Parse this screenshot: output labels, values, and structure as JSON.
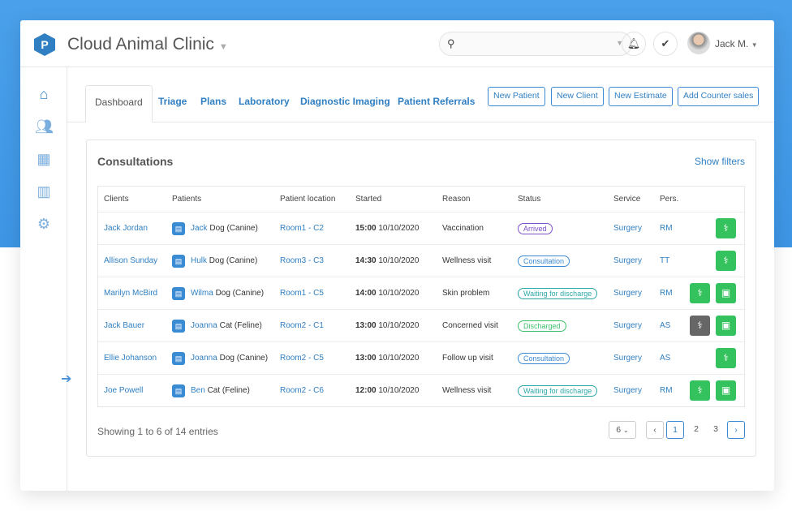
{
  "header": {
    "app_title": "Cloud Animal Clinic",
    "user_name": "Jack M.",
    "search_placeholder": ""
  },
  "tabs": [
    "Dashboard",
    "Triage",
    "Plans",
    "Laboratory",
    "Diagnostic Imaging",
    "Patient Referrals"
  ],
  "actions": [
    "New Patient",
    "New Client",
    "New Estimate",
    "Add Counter sales"
  ],
  "panel": {
    "title": "Consultations",
    "show_filters": "Show filters"
  },
  "columns": [
    "Clients",
    "Patients",
    "Patient location",
    "Started",
    "Reason",
    "Status",
    "Service",
    "Pers."
  ],
  "rows": [
    {
      "client": "Jack Jordan",
      "patient": "Jack",
      "species": "Dog (Canine)",
      "location": "Room1 - C2",
      "time": "15:00",
      "date": "10/10/2020",
      "reason": "Vaccination",
      "status": "Arrived",
      "service": "Surgery",
      "pers": "RM"
    },
    {
      "client": "Allison Sunday",
      "patient": "Hulk",
      "species": "Dog (Canine)",
      "location": "Room3 - C3",
      "time": "14:30",
      "date": "10/10/2020",
      "reason": "Wellness visit",
      "status": "Consultation",
      "service": "Surgery",
      "pers": "TT"
    },
    {
      "client": "Marilyn McBird",
      "patient": "Wilma",
      "species": "Dog (Canine)",
      "location": "Room1 - C5",
      "time": "14:00",
      "date": "10/10/2020",
      "reason": "Skin problem",
      "status": "Waiting for discharge",
      "service": "Surgery",
      "pers": "RM"
    },
    {
      "client": "Jack Bauer",
      "patient": "Joanna",
      "species": "Cat (Feline)",
      "location": "Room2 - C1",
      "time": "13:00",
      "date": "10/10/2020",
      "reason": "Concerned visit",
      "status": "Discharged",
      "service": "Surgery",
      "pers": "AS"
    },
    {
      "client": "Ellie Johanson",
      "patient": "Joanna",
      "species": "Dog (Canine)",
      "location": "Room2 - C5",
      "time": "13:00",
      "date": "10/10/2020",
      "reason": "Follow up visit",
      "status": "Consultation",
      "service": "Surgery",
      "pers": "AS"
    },
    {
      "client": "Joe Powell",
      "patient": "Ben",
      "species": "Cat (Feline)",
      "location": "Room2 - C6",
      "time": "12:00",
      "date": "10/10/2020",
      "reason": "Wellness visit",
      "status": "Waiting for discharge",
      "service": "Surgery",
      "pers": "RM"
    }
  ],
  "status_colors": {
    "Arrived": "#7b4fc9",
    "Consultation": "#3a8ad4",
    "Waiting for discharge": "#2aa7a7",
    "Discharged": "#3cc26a"
  },
  "footer": {
    "showing": "Showing 1 to 6 of 14 entries",
    "page_size": "6",
    "pages": [
      "1",
      "2",
      "3"
    ],
    "current_page": "1"
  }
}
